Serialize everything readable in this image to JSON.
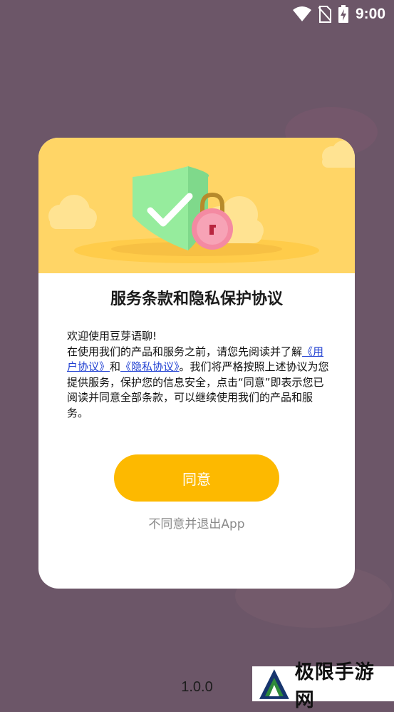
{
  "status_bar": {
    "time": "9:00",
    "icons": [
      "wifi-icon",
      "no-sim-icon",
      "battery-charging-icon"
    ]
  },
  "dialog": {
    "illustration": "shield-check-lock-icon",
    "title": "服务条款和隐私保护协议",
    "body": {
      "greeting": "欢迎使用豆芽语聊!",
      "intro": "在使用我们的产品和服务之前，请您先阅读并了解",
      "user_agreement_link": "《用户协议》",
      "and": "和",
      "privacy_link": "《隐私协议》",
      "rest": "。我们将严格按照上述协议为您提供服务，保护您的信息安全，点击“同意”即表示您已阅读并同意全部条款，可以继续使用我们的产品和服务。"
    },
    "agree_label": "同意",
    "disagree_label": "不同意并退出App"
  },
  "version": "1.0.0",
  "watermark": {
    "text": "极限手游网",
    "logo": "jixian-logo-icon"
  },
  "colors": {
    "overlay": "#6c5668",
    "header": "#ffd566",
    "button": "#fdb900",
    "link": "#1f3fd1"
  }
}
